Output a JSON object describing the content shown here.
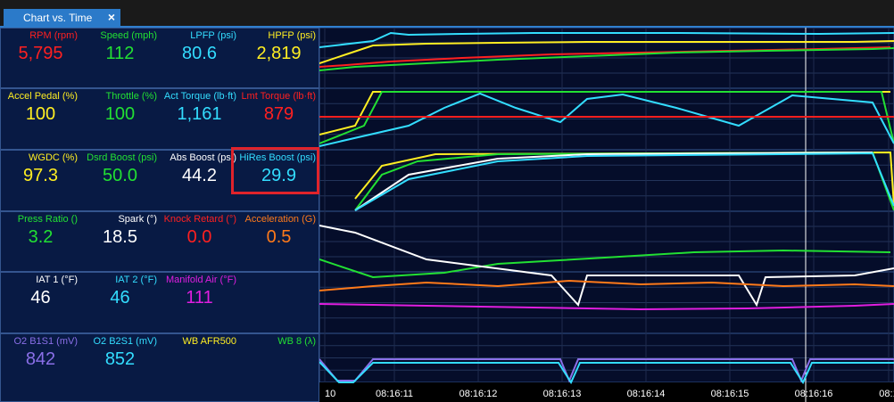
{
  "tab": {
    "title": "Chart vs. Time",
    "close_icon": "×"
  },
  "colors": {
    "red": "#ff2020",
    "green": "#22e033",
    "cyan": "#33ddff",
    "yellow": "#ffee22",
    "white": "#ffffff",
    "orange": "#ff7a1a",
    "magenta": "#e01ee0",
    "purple": "#8a6fe8"
  },
  "gauges": [
    [
      {
        "label": "RPM (rpm)",
        "value": "5,795",
        "color": "red"
      },
      {
        "label": "Speed (mph)",
        "value": "112",
        "color": "green"
      },
      {
        "label": "LPFP (psi)",
        "value": "80.6",
        "color": "cyan"
      },
      {
        "label": "HPFP (psi)",
        "value": "2,819",
        "color": "yellow"
      }
    ],
    [
      {
        "label": "Accel Pedal (%)",
        "value": "100",
        "color": "yellow"
      },
      {
        "label": "Throttle (%)",
        "value": "100",
        "color": "green"
      },
      {
        "label": "Act Torque (lb·ft)",
        "value": "1,161",
        "color": "cyan"
      },
      {
        "label": "Lmt Torque (lb·ft)",
        "value": "879",
        "color": "red"
      }
    ],
    [
      {
        "label": "WGDC (%)",
        "value": "97.3",
        "color": "yellow"
      },
      {
        "label": "Dsrd Boost (psi)",
        "value": "50.0",
        "color": "green"
      },
      {
        "label": "Abs Boost (psi)",
        "value": "44.2",
        "color": "white"
      },
      {
        "label": "HiRes Boost (psi)",
        "value": "29.9",
        "color": "cyan"
      }
    ],
    [
      {
        "label": "Press Ratio ()",
        "value": "3.2",
        "color": "green"
      },
      {
        "label": "Spark (°)",
        "value": "18.5",
        "color": "white"
      },
      {
        "label": "Knock Retard (°)",
        "value": "0.0",
        "color": "red"
      },
      {
        "label": "Acceleration (G)",
        "value": "0.5",
        "color": "orange"
      }
    ],
    [
      {
        "label": "IAT 1 (°F)",
        "value": "46",
        "color": "white"
      },
      {
        "label": "IAT 2 (°F)",
        "value": "46",
        "color": "cyan"
      },
      {
        "label": "Manifold Air (°F)",
        "value": "111",
        "color": "magenta"
      },
      {
        "label": "",
        "value": "",
        "color": "white"
      }
    ],
    [
      {
        "label": "O2 B1S1 (mV)",
        "value": "842",
        "color": "purple"
      },
      {
        "label": "O2 B2S1 (mV)",
        "value": "852",
        "color": "cyan"
      },
      {
        "label": "WB AFR500",
        "value": "",
        "color": "yellow"
      },
      {
        "label": "WB 8 (λ)",
        "value": "",
        "color": "green"
      }
    ]
  ],
  "time_axis": {
    "ticks": [
      "10",
      "08:16:11",
      "08:16:12",
      "08:16:13",
      "08:16:14",
      "08:16:15",
      "08:16:16",
      "08:1"
    ],
    "cursor": "08:16:16"
  }
}
